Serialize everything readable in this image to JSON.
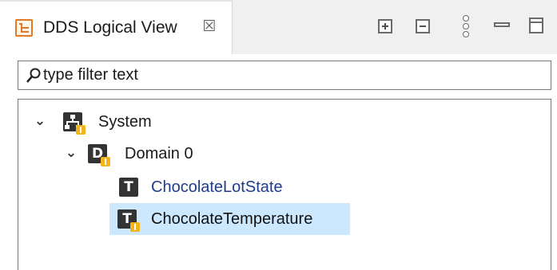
{
  "view": {
    "title": "DDS Logical View",
    "close_glyph": "☒",
    "icons": {
      "tab": "tree-view-icon",
      "expand_all": "expand-all-icon",
      "collapse_all": "collapse-all-icon",
      "view_menu": "view-menu-icon",
      "minimize": "minimize-icon",
      "maximize": "maximize-icon"
    }
  },
  "filter": {
    "placeholder": "type filter text",
    "value": "",
    "icon": "filter-icon"
  },
  "tree": {
    "nodes": [
      {
        "label": "System",
        "icon_letter": "",
        "icon": "system-icon",
        "level": 0,
        "expanded": true,
        "warning": true,
        "selected": false
      },
      {
        "label": "Domain 0",
        "icon_letter": "D",
        "icon": "domain-icon",
        "level": 1,
        "expanded": true,
        "warning": true,
        "selected": false
      },
      {
        "label": "ChocolateLotState",
        "icon_letter": "T",
        "icon": "topic-icon",
        "level": 2,
        "expanded": false,
        "warning": false,
        "selected": false
      },
      {
        "label": "ChocolateTemperature",
        "icon_letter": "T",
        "icon": "topic-icon",
        "level": 2,
        "expanded": false,
        "warning": true,
        "selected": true
      }
    ]
  },
  "colors": {
    "selection": "#cce8ff",
    "warning_badge": "#f3b41b",
    "tab_icon": "#e87722",
    "node_icon": "#333333",
    "link_text": "#1f3c8c"
  }
}
